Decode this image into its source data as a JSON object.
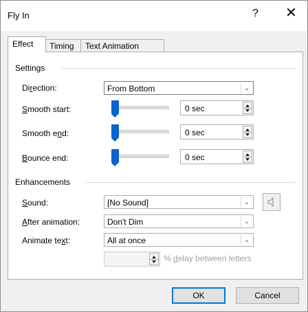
{
  "window": {
    "title": "Fly In",
    "help_label": "?",
    "close_label": "✕"
  },
  "tabs": [
    {
      "label": "Effect",
      "active": true
    },
    {
      "label": "Timing",
      "active": false
    },
    {
      "label": "Text Animation",
      "active": false
    }
  ],
  "settings": {
    "group_label": "Settings",
    "direction": {
      "label_pre": "Di",
      "label_key": "r",
      "label_post": "ection:",
      "value": "From Bottom"
    },
    "smooth_start": {
      "label_pre": "",
      "label_key": "S",
      "label_post": "mooth start:",
      "value": "0 sec",
      "slider_level": 0
    },
    "smooth_end": {
      "label_pre": "Smooth e",
      "label_key": "n",
      "label_post": "d:",
      "value": "0 sec",
      "slider_level": 0
    },
    "bounce_end": {
      "label_pre": "",
      "label_key": "B",
      "label_post": "ounce end:",
      "value": "0 sec",
      "slider_level": 0
    }
  },
  "enhancements": {
    "group_label": "Enhancements",
    "sound": {
      "label_pre": "",
      "label_key": "S",
      "label_post": "ound:",
      "value": "[No Sound]"
    },
    "after_animation": {
      "label_pre": "",
      "label_key": "A",
      "label_post": "fter animation:",
      "value": "Don't Dim"
    },
    "animate_text": {
      "label_pre": "Animate te",
      "label_key": "x",
      "label_post": "t:",
      "value": "All at once"
    },
    "delay": {
      "value": "",
      "label_pre": "% ",
      "label_key": "d",
      "label_post": "elay between letters"
    }
  },
  "buttons": {
    "ok": "OK",
    "cancel": "Cancel"
  },
  "icons": {
    "sound_icon": "speaker-icon",
    "dropdown_icon": "chevron-down-icon"
  },
  "colors": {
    "accent": "#0078d7",
    "slider_thumb": "#0a63c9"
  }
}
